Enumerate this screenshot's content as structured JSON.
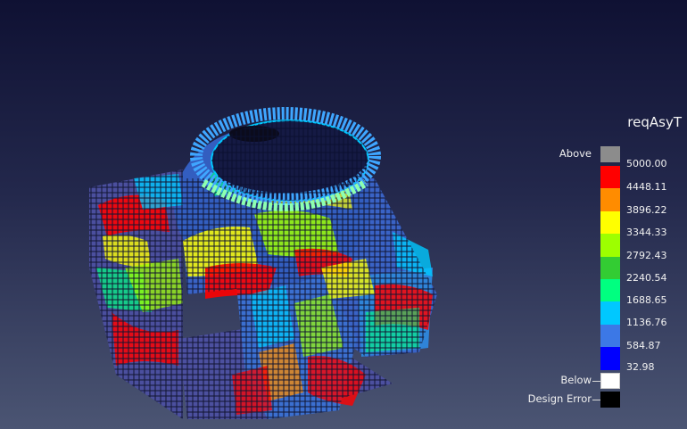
{
  "legend": {
    "title": "reqAsyT",
    "above_label": "Above",
    "below_label": "Below",
    "error_label": "Design Error",
    "above_color": "#8c8c8c",
    "below_color": "#ffffff",
    "error_color": "#000000",
    "bands": [
      {
        "color": "#ff0000",
        "value": "5000.00"
      },
      {
        "color": "#ff8c00",
        "value": "4448.11"
      },
      {
        "color": "#ffff00",
        "value": "3896.22"
      },
      {
        "color": "#9dff00",
        "value": "3344.33"
      },
      {
        "color": "#33cc33",
        "value": "2792.43"
      },
      {
        "color": "#00ff80",
        "value": "2240.54"
      },
      {
        "color": "#00c8ff",
        "value": "1688.65"
      },
      {
        "color": "#3c78e6",
        "value": "1136.76"
      },
      {
        "color": "#0000ff",
        "value": "584.87"
      }
    ],
    "min_value": "32.98"
  },
  "model": {
    "palette": [
      "#4a4a9a",
      "#3c78e6",
      "#00c8ff",
      "#00ff80",
      "#9dff00",
      "#ffff00",
      "#ff8c00",
      "#ff0000",
      "#c8007a"
    ],
    "mesh_color": "#161a3a"
  }
}
